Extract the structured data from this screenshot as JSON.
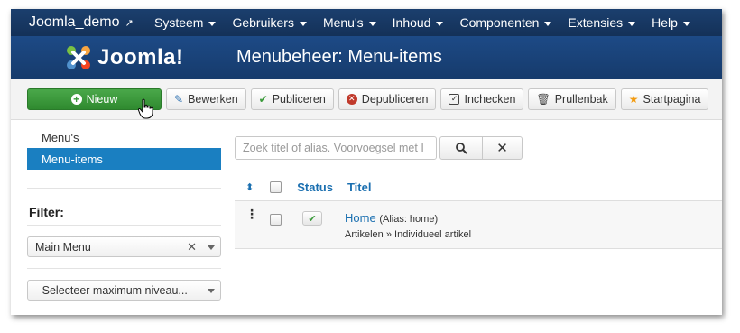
{
  "topnav": {
    "brand": "Joomla_demo",
    "items": [
      {
        "label": "Systeem"
      },
      {
        "label": "Gebruikers"
      },
      {
        "label": "Menu's"
      },
      {
        "label": "Inhoud"
      },
      {
        "label": "Componenten"
      },
      {
        "label": "Extensies"
      },
      {
        "label": "Help"
      }
    ]
  },
  "header": {
    "logo_text": "Joomla!",
    "title": "Menubeheer: Menu-items"
  },
  "toolbar": {
    "new_label": "Nieuw",
    "edit_label": "Bewerken",
    "publish_label": "Publiceren",
    "unpublish_label": "Depubliceren",
    "checkin_label": "Inchecken",
    "trash_label": "Prullenbak",
    "home_label": "Startpagina"
  },
  "sidebar": {
    "items": [
      {
        "label": "Menu's",
        "active": false
      },
      {
        "label": "Menu-items",
        "active": true
      }
    ],
    "filter_label": "Filter:",
    "menu_select": "Main Menu",
    "level_select": "- Selecteer maximum niveau..."
  },
  "search": {
    "placeholder": "Zoek titel of alias. Voorvoegsel met I"
  },
  "table": {
    "headers": {
      "status": "Status",
      "title": "Titel"
    },
    "rows": [
      {
        "title": "Home",
        "alias": "(Alias: home)",
        "type": "Artikelen » Individueel artikel",
        "published": true
      }
    ]
  },
  "colors": {
    "nav_bg": "#143158",
    "header_bg": "#1d4a86",
    "accent_blue": "#1a7fc1",
    "new_button": "#3a9a3a"
  }
}
